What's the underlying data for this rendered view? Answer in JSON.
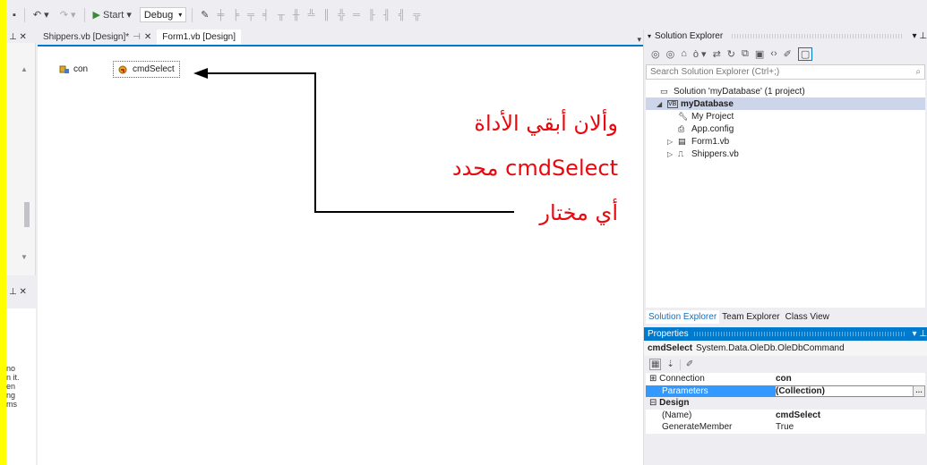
{
  "toolbar": {
    "start_label": "Start",
    "config_value": "Debug"
  },
  "left_panel": {
    "text_fragments": [
      "no",
      "n it.",
      "en",
      "ng",
      "ms"
    ]
  },
  "tabs": [
    {
      "label": "Shippers.vb [Design]*",
      "active": false
    },
    {
      "label": "Form1.vb [Design]",
      "active": true
    }
  ],
  "designer": {
    "components": [
      {
        "label": "con"
      },
      {
        "label": "cmdSelect"
      }
    ]
  },
  "annotation": {
    "line1": "وألان أبقي الأداة",
    "line2": "cmdSelect محدد",
    "line3": "أي مختار",
    "color": "#e8090f"
  },
  "solution_explorer": {
    "title": "Solution Explorer",
    "search_placeholder": "Search Solution Explorer (Ctrl+;)",
    "solution_label": "Solution 'myDatabase' (1 project)",
    "project_label": "myDatabase",
    "items": [
      "My Project",
      "App.config",
      "Form1.vb",
      "Shippers.vb"
    ],
    "bottom_tabs": [
      "Solution Explorer",
      "Team Explorer",
      "Class View"
    ]
  },
  "properties": {
    "title": "Properties",
    "object_name": "cmdSelect",
    "object_type": "System.Data.OleDb.OleDbCommand",
    "rows": [
      {
        "name": "Connection",
        "value": "con"
      },
      {
        "name": "Parameters",
        "value": "(Collection)"
      }
    ],
    "category_design": "Design",
    "design_rows": [
      {
        "name": "(Name)",
        "value": "cmdSelect"
      },
      {
        "name": "GenerateMember",
        "value": "True"
      }
    ]
  },
  "colors": {
    "accent": "#007acc",
    "highlight": "#ffff00",
    "selected_row": "#3399ff"
  }
}
